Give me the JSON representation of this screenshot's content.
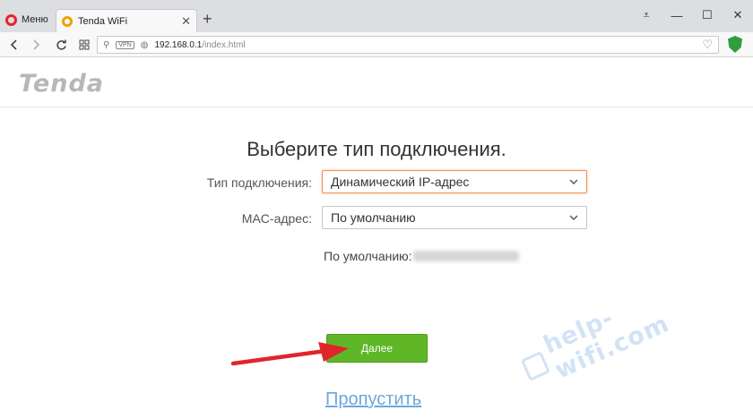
{
  "browser": {
    "menu_label": "Меню",
    "tab_title": "Tenda WiFi",
    "url_host": "192.168.0.1",
    "url_path": "/index.html",
    "vpn_badge": "VPN",
    "icons": {
      "menu": "opera-logo-icon",
      "tab_favicon": "tenda-favicon-icon",
      "back": "chevron-left-icon",
      "forward": "chevron-right-icon",
      "reload": "reload-icon",
      "speed_dial": "grid-icon",
      "search": "search-icon",
      "site_info": "globe-icon",
      "bookmark": "heart-icon",
      "adblock": "shield-icon"
    }
  },
  "page": {
    "logo": "Tenda",
    "title": "Выберите тип подключения.",
    "connection_type": {
      "label": "Тип подключения:",
      "value": "Динамический IP-адрес"
    },
    "mac": {
      "label": "MAC-адрес:",
      "value": "По умолчанию"
    },
    "default_mac_label": "По умолчанию:",
    "next_button": "Далее",
    "skip_link": "Пропустить"
  },
  "watermark": {
    "text": "help-wifi.com"
  },
  "colors": {
    "accent_green": "#5fb627",
    "link_blue": "#6ba7dc",
    "active_border": "#f08f55",
    "opera_red": "#e8232a",
    "annotation_arrow": "#e0262b"
  }
}
